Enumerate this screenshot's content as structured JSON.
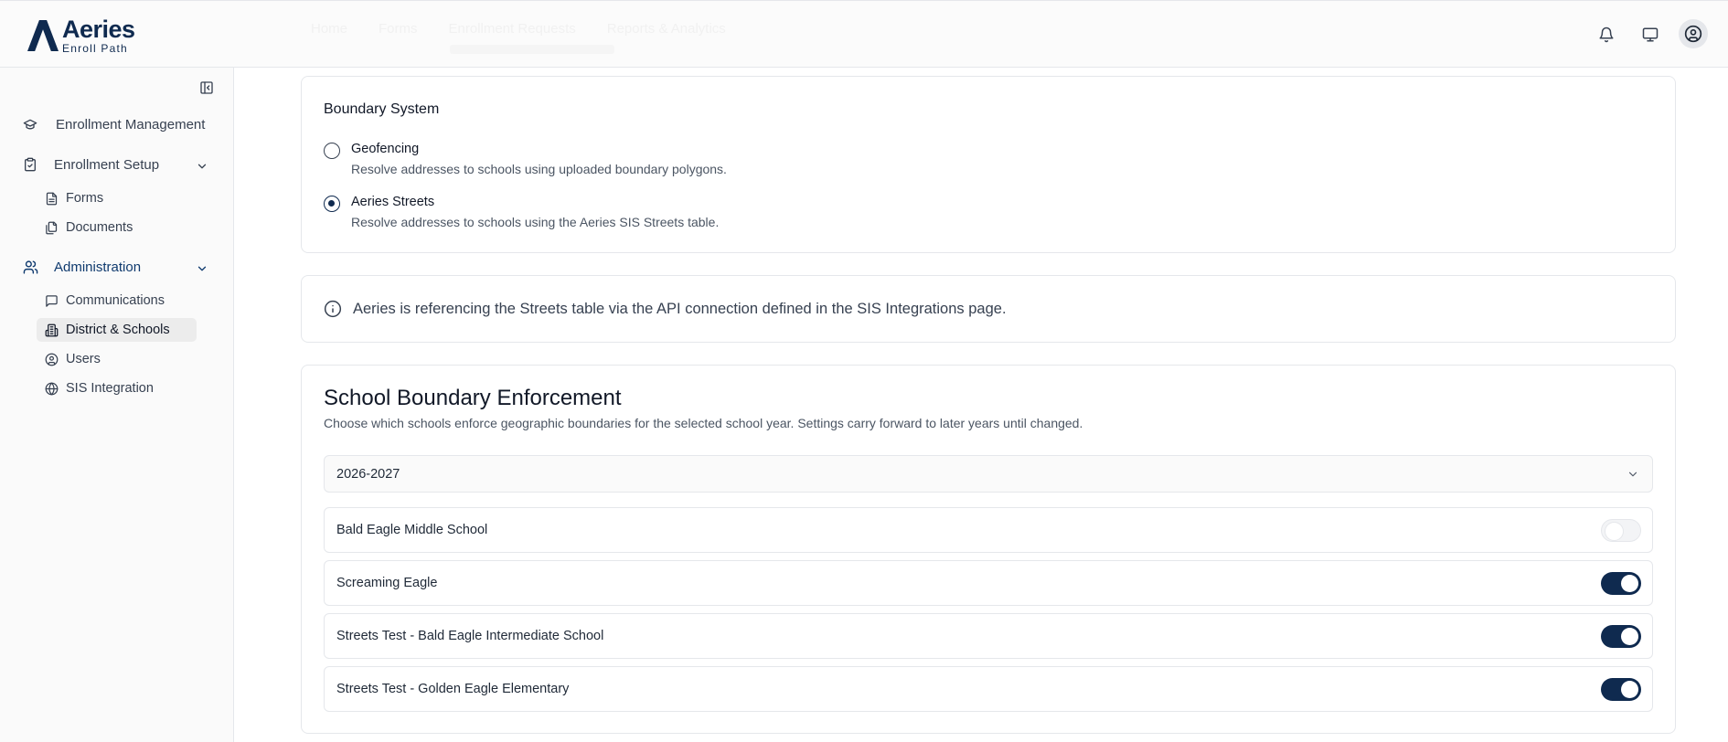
{
  "header": {
    "logo_title": "Aeries",
    "logo_sub": "Enroll Path",
    "ghost_tabs": [
      "Home",
      "Forms",
      "Enrollment Requests",
      "Reports & Analytics"
    ],
    "icons": [
      "bell-icon",
      "monitor-icon",
      "user-circle-icon"
    ]
  },
  "sidebar": {
    "collapse_icon": "sidebar-collapse-icon",
    "items": [
      {
        "label": "Enrollment Management",
        "icon": "graduation-cap-icon"
      },
      {
        "label": "Enrollment Setup",
        "icon": "clipboard-check-icon",
        "expanded": true,
        "children": [
          {
            "label": "Forms",
            "icon": "file-text-icon"
          },
          {
            "label": "Documents",
            "icon": "files-icon"
          }
        ]
      },
      {
        "label": "Administration",
        "icon": "users-icon",
        "expanded": true,
        "children": [
          {
            "label": "Communications",
            "icon": "message-square-icon"
          },
          {
            "label": "District & Schools",
            "icon": "building-icon",
            "selected": true
          },
          {
            "label": "Users",
            "icon": "user-circle-icon"
          },
          {
            "label": "SIS Integration",
            "icon": "globe-icon"
          }
        ]
      }
    ]
  },
  "boundary_system": {
    "title": "Boundary System",
    "options": [
      {
        "label": "Geofencing",
        "description": "Resolve addresses to schools using uploaded boundary polygons.",
        "checked": false
      },
      {
        "label": "Aeries Streets",
        "description": "Resolve addresses to schools using the Aeries SIS Streets table.",
        "checked": true
      }
    ]
  },
  "info_banner": {
    "icon": "info-icon",
    "text": "Aeries is referencing the Streets table via the API connection defined in the SIS Integrations page."
  },
  "enforcement": {
    "title": "School Boundary Enforcement",
    "description": "Choose which schools enforce geographic boundaries for the selected school year. Settings carry forward to later years until changed.",
    "school_year": "2026-2027",
    "schools": [
      {
        "name": "Bald Eagle Middle School",
        "enabled": false
      },
      {
        "name": "Screaming Eagle",
        "enabled": true
      },
      {
        "name": "Streets Test - Bald Eagle Intermediate School",
        "enabled": true
      },
      {
        "name": "Streets Test - Golden Eagle Elementary",
        "enabled": true
      }
    ]
  },
  "colors": {
    "brand": "#0f2a4f",
    "active_nav": "#0f3a6e",
    "border": "#e5e7eb"
  }
}
